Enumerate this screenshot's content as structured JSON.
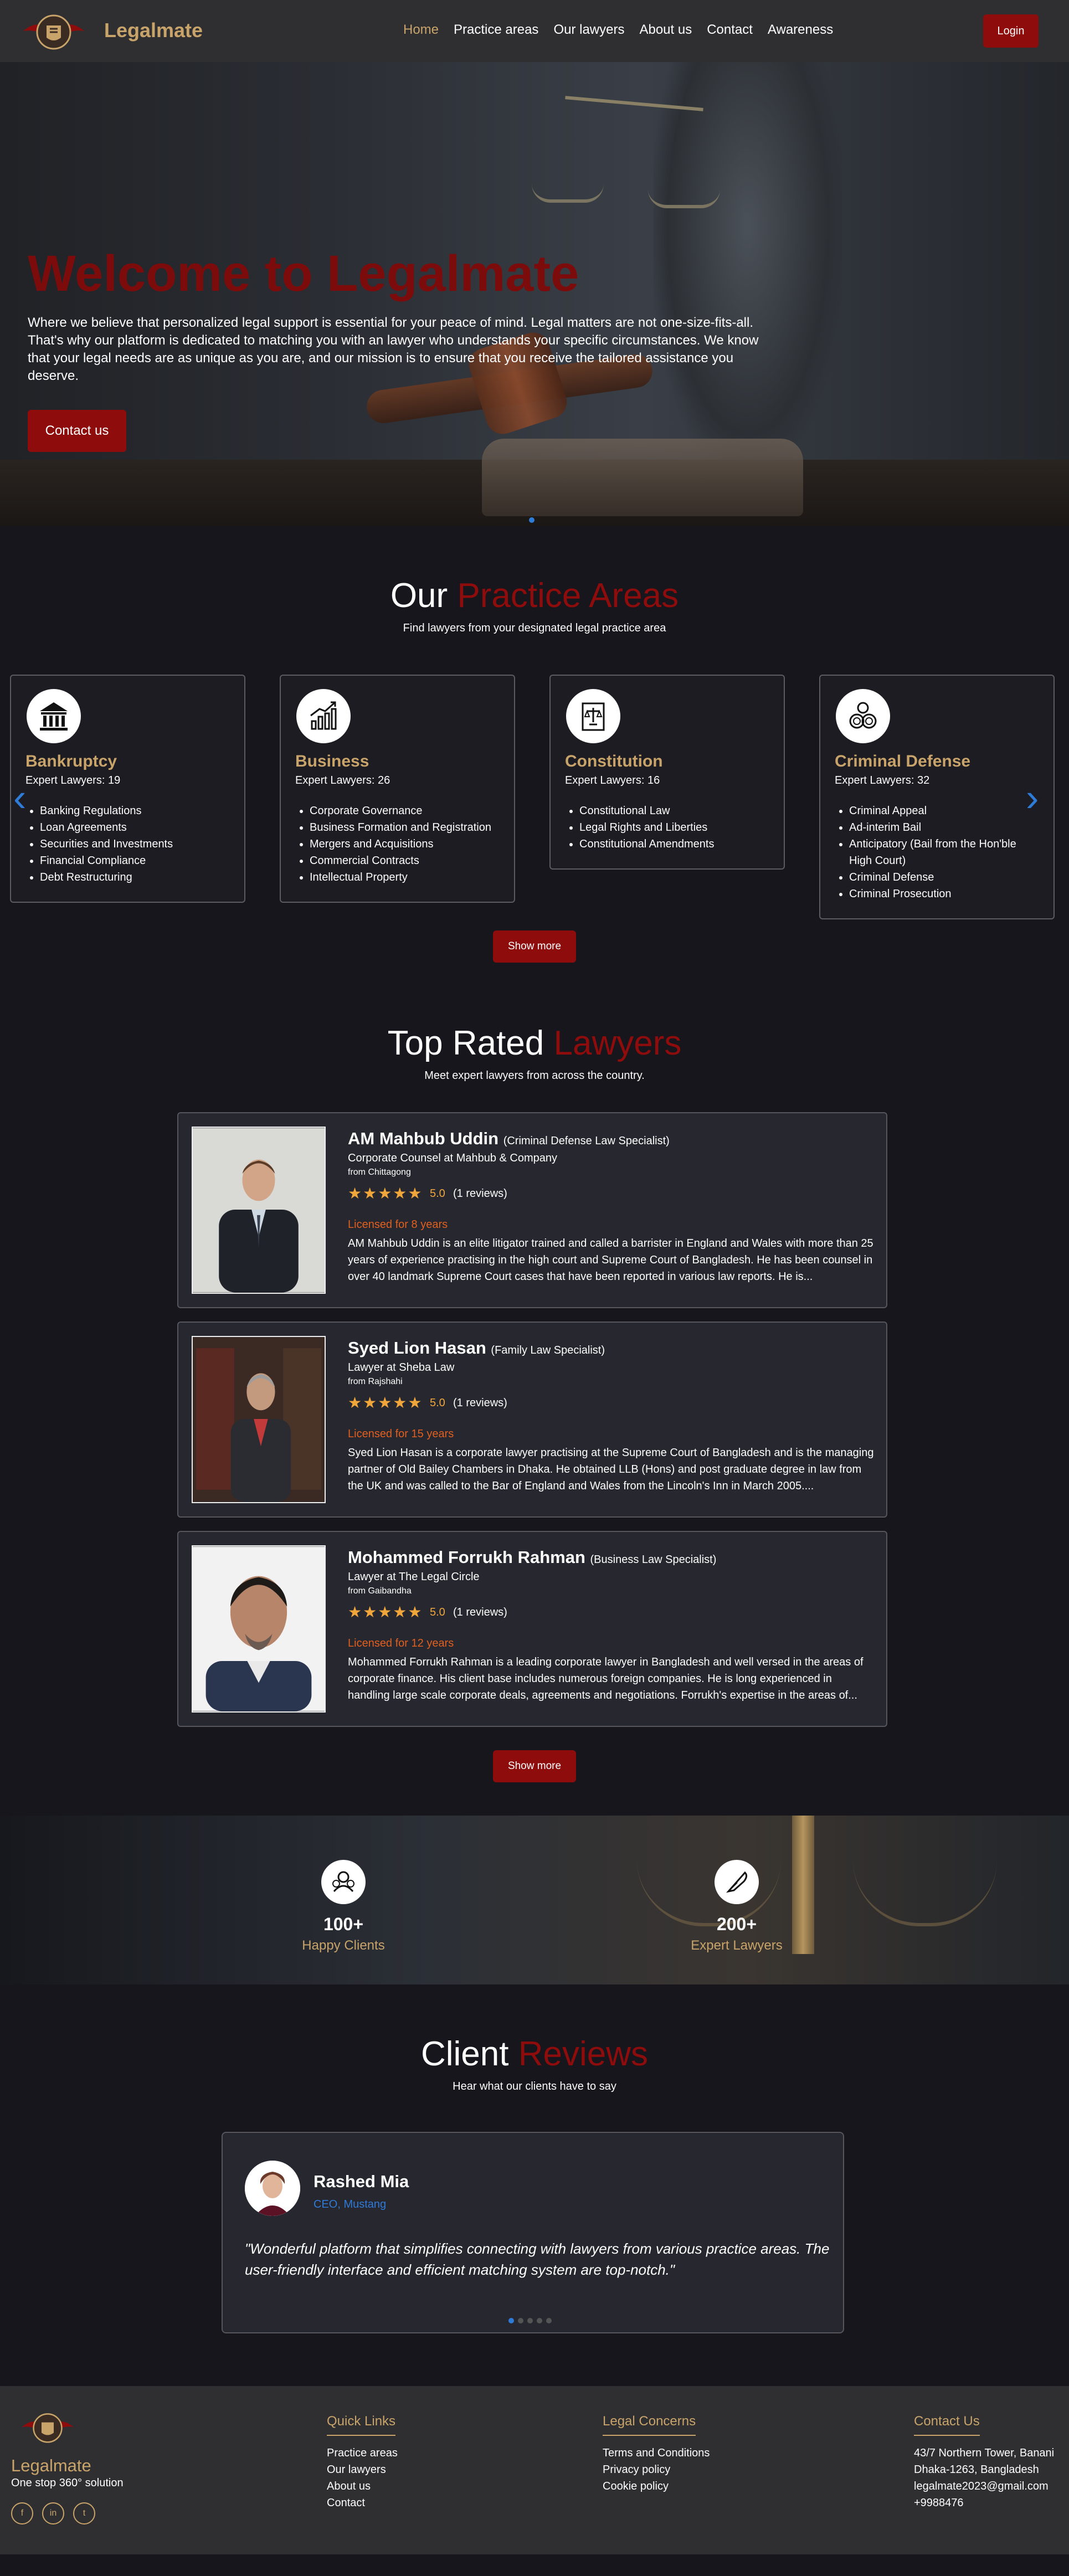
{
  "nav": {
    "brand": "Legalmate",
    "links": [
      "Home",
      "Practice areas",
      "Our lawyers",
      "About us",
      "Contact",
      "Awareness"
    ],
    "login": "Login",
    "accent": "#c9a46a",
    "brand_red": "#8f0c0c"
  },
  "hero": {
    "title": "Welcome to Legalmate",
    "text": "Where we believe that personalized legal support is essential for your peace of mind. Legal matters are not one-size-fits-all. That's why our platform is dedicated to matching you with an lawyer who understands your specific circumstances. We know that your legal needs are as unique as you are, and our mission is to ensure that you receive the tailored assistance you deserve.",
    "cta": "Contact us"
  },
  "practice": {
    "title_white": "Our",
    "title_red": "Practice Areas",
    "subtitle": "Find lawyers from your designated legal practice area",
    "cards": [
      {
        "icon": "bank-icon",
        "name": "Bankruptcy",
        "count": "Expert Lawyers: 19",
        "items": [
          "Banking Regulations",
          "Loan Agreements",
          "Securities and Investments",
          "Financial Compliance",
          "Debt Restructuring"
        ]
      },
      {
        "icon": "chart-growth-icon",
        "name": "Business",
        "count": "Expert Lawyers: 26",
        "items": [
          "Corporate Governance",
          "Business Formation and Registration",
          "Mergers and Acquisitions",
          "Commercial Contracts",
          "Intellectual Property"
        ]
      },
      {
        "icon": "constitution-scale-icon",
        "name": "Constitution",
        "count": "Expert Lawyers: 16",
        "items": [
          "Constitutional Law",
          "Legal Rights and Liberties",
          "Constitutional Amendments"
        ]
      },
      {
        "icon": "handcuffs-icon",
        "name": "Criminal Defense",
        "count": "Expert Lawyers: 32",
        "items": [
          "Criminal Appeal",
          "Ad-interim Bail",
          "Anticipatory (Bail from the Hon'ble High Court)",
          "Criminal Defense",
          "Criminal Prosecution"
        ]
      }
    ],
    "show_more": "Show more"
  },
  "lawyers": {
    "title_white": "Top Rated",
    "title_red": "Lawyers",
    "subtitle": "Meet expert lawyers from across the country.",
    "list": [
      {
        "name": "AM Mahbub Uddin",
        "specialty": "(Criminal Defense Law Specialist)",
        "position": "Corporate Counsel at Mahbub & Company",
        "from": "from Chittagong",
        "rating": "5.0",
        "reviews": "(1 reviews)",
        "licensed": "Licensed for 8 years",
        "bio": "AM Mahbub Uddin is an elite litigator trained and called a barrister in England and Wales with more than 25 years of experience practising in the high court and Supreme Court of Bangladesh. He has been counsel in over 40 landmark Supreme Court cases that have been reported in various law reports. He is..."
      },
      {
        "name": "Syed Lion Hasan",
        "specialty": "(Family Law Specialist)",
        "position": "Lawyer at Sheba Law",
        "from": "from Rajshahi",
        "rating": "5.0",
        "reviews": "(1 reviews)",
        "licensed": "Licensed for 15 years",
        "bio": "Syed Lion Hasan is a corporate lawyer practising at the Supreme Court of Bangladesh and is the managing partner of Old Bailey Chambers in Dhaka. He obtained LLB (Hons) and post graduate degree in law from the UK and was called to the Bar of England and Wales from the Lincoln's Inn in March 2005...."
      },
      {
        "name": "Mohammed Forrukh Rahman",
        "specialty": "(Business Law Specialist)",
        "position": "Lawyer at The Legal Circle",
        "from": "from Gaibandha",
        "rating": "5.0",
        "reviews": "(1 reviews)",
        "licensed": "Licensed for 12 years",
        "bio": "Mohammed Forrukh Rahman is a leading corporate lawyer in Bangladesh and well versed in the areas of corporate finance. His client base includes numerous foreign companies. He is long experienced in handling large scale corporate deals, agreements and negotiations. Forrukh's expertise in the areas of..."
      }
    ],
    "show_more": "Show more"
  },
  "stats": [
    {
      "icon": "users-icon",
      "number": "100+",
      "label": "Happy Clients"
    },
    {
      "icon": "feather-pen-icon",
      "number": "200+",
      "label": "Expert Lawyers"
    }
  ],
  "reviews": {
    "title_white": "Client",
    "title_red": "Reviews",
    "subtitle": "Hear what our clients have to say",
    "name": "Rashed Mia",
    "role": "CEO, Mustang",
    "quote": "\"Wonderful platform that simplifies connecting with lawyers from various practice areas. The user-friendly interface and efficient matching system are top-notch.\""
  },
  "footer": {
    "brand": "Legalmate",
    "tagline": "One stop 360° solution",
    "quick_links_title": "Quick Links",
    "quick_links": [
      "Practice areas",
      "Our lawyers",
      "About us",
      "Contact"
    ],
    "legal_title": "Legal Concerns",
    "legal_links": [
      "Terms and Conditions",
      "Privacy policy",
      "Cookie policy"
    ],
    "contact_title": "Contact Us",
    "contact_lines": [
      "43/7 Northern Tower, Banani",
      "Dhaka-1263, Bangladesh",
      "legalmate2023@gmail.com",
      "+9988476"
    ]
  }
}
